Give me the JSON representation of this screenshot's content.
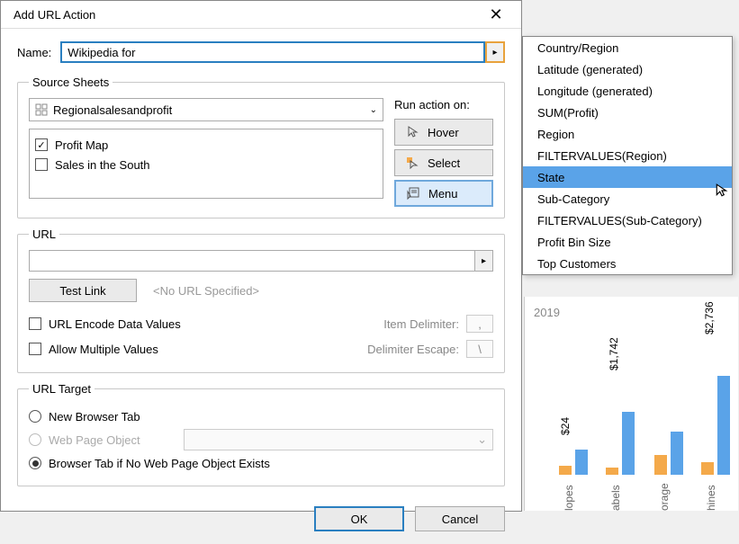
{
  "dialog": {
    "title": "Add URL Action",
    "name_label": "Name:",
    "name_value": "Wikipedia for"
  },
  "source": {
    "legend": "Source Sheets",
    "combo": "Regionalsalesandprofit",
    "sheets": [
      "Profit Map",
      "Sales in the South"
    ],
    "run_label": "Run action on:",
    "buttons": {
      "hover": "Hover",
      "select": "Select",
      "menu": "Menu"
    }
  },
  "url": {
    "legend": "URL",
    "test": "Test Link",
    "no_url": "<No URL Specified>",
    "encode": "URL Encode Data Values",
    "allow_multi": "Allow Multiple Values",
    "item_delim_label": "Item Delimiter:",
    "item_delim": ",",
    "escape_label": "Delimiter Escape:",
    "escape": "\\"
  },
  "target": {
    "legend": "URL Target",
    "new_tab": "New Browser Tab",
    "wpo": "Web Page Object",
    "browser_tab": "Browser Tab if No Web Page Object Exists"
  },
  "buttons": {
    "ok": "OK",
    "cancel": "Cancel"
  },
  "dropdown": [
    "Country/Region",
    "Latitude (generated)",
    "Longitude (generated)",
    "SUM(Profit)",
    "Region",
    "FILTERVALUES(Region)",
    "State",
    "Sub-Category",
    "FILTERVALUES(Sub-Category)",
    "Profit Bin Size",
    "Top Customers"
  ],
  "dropdown_hover_index": 6,
  "chart_data": {
    "type": "bar",
    "year": "2019",
    "visible_categories": [
      "lopes",
      "abels",
      "orage",
      "hines"
    ],
    "visible_values": [
      "$24",
      "$1,742",
      "",
      "$2,736"
    ]
  }
}
